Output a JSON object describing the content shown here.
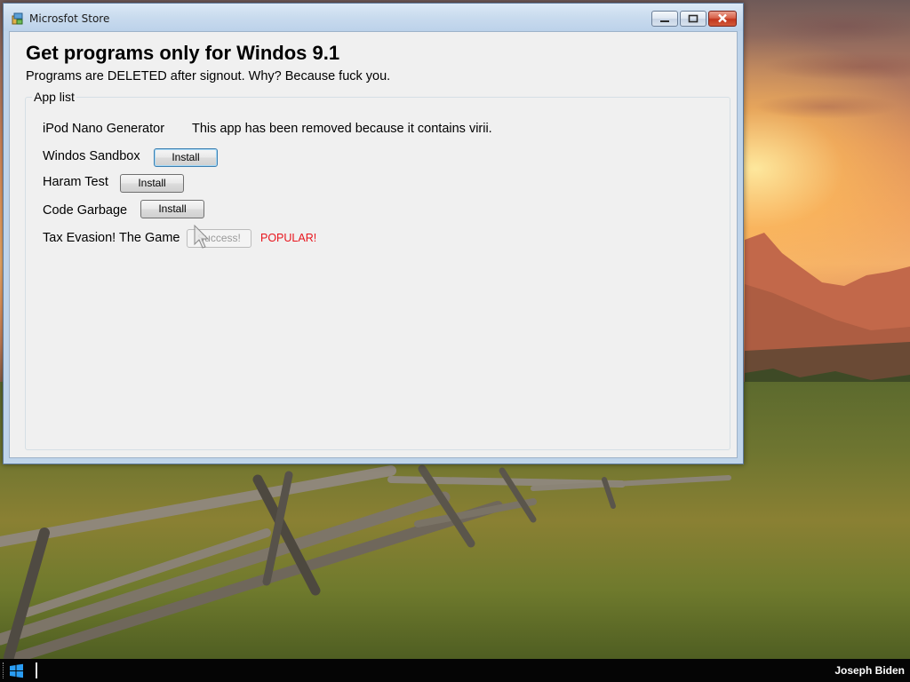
{
  "window": {
    "title": "Microsfot Store",
    "heading": "Get programs only for Windos 9.1",
    "subheading": "Programs are DELETED after signout. Why? Because fuck you."
  },
  "app_list": {
    "group_label": "App list",
    "apps": [
      {
        "name": "iPod Nano Generator",
        "note": "This app has been removed because it contains virii."
      },
      {
        "name": "Windos Sandbox",
        "button_label": "Install"
      },
      {
        "name": "Haram Test",
        "button_label": "Install"
      },
      {
        "name": "Code Garbage",
        "button_label": "Install"
      },
      {
        "name": "Tax Evasion! The Game",
        "button_label": "Success!",
        "badge": "POPULAR!"
      }
    ]
  },
  "taskbar": {
    "user_name": "Joseph Biden"
  },
  "colors": {
    "popular_badge": "#e8141c",
    "taskbar": "#050505",
    "titlebar": "#c9dbee",
    "close_button": "#c2351d"
  }
}
